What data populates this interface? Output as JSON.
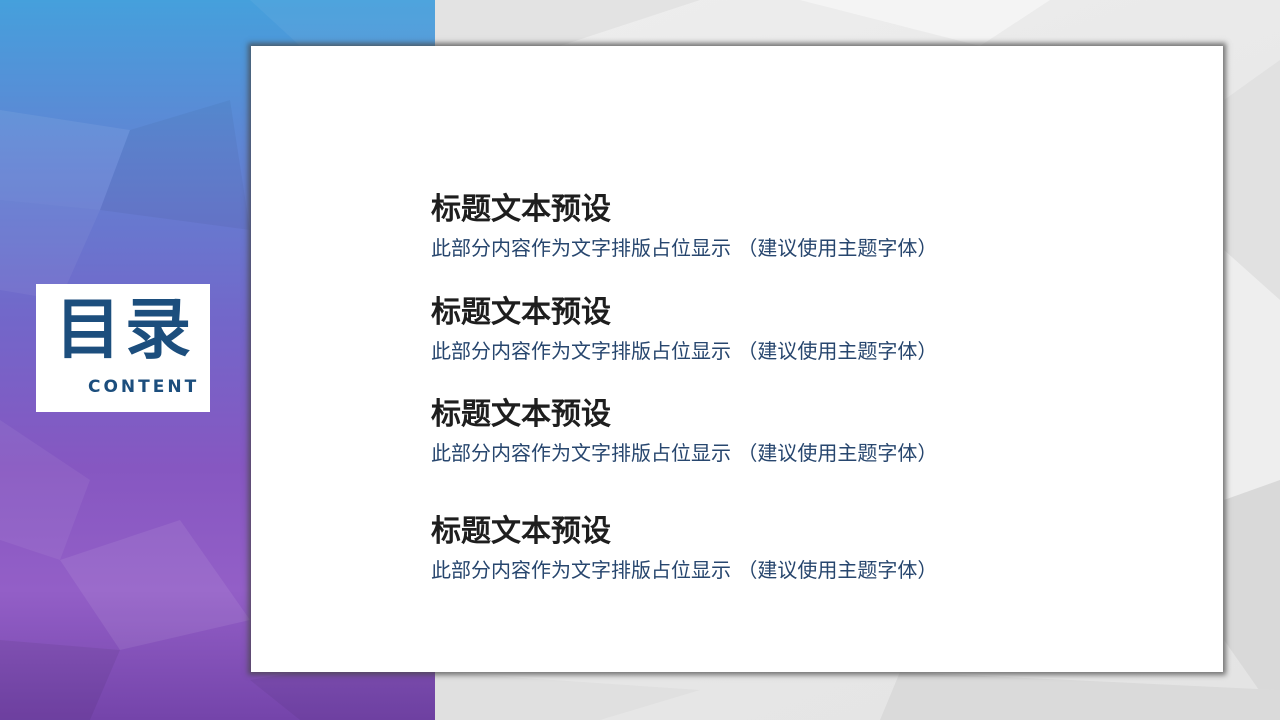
{
  "toc": {
    "title": "目录",
    "subtitle": "CONTENT"
  },
  "items": [
    {
      "title": "标题文本预设",
      "desc": "此部分内容作为文字排版占位显示 （建议使用主题字体）"
    },
    {
      "title": "标题文本预设",
      "desc": "此部分内容作为文字排版占位显示 （建议使用主题字体）"
    },
    {
      "title": "标题文本预设",
      "desc": "此部分内容作为文字排版占位显示 （建议使用主题字体）"
    },
    {
      "title": "标题文本预设",
      "desc": "此部分内容作为文字排版占位显示 （建议使用主题字体）"
    }
  ],
  "colors": {
    "accent": "#1c4e7d",
    "title_text": "#1e1e1e",
    "desc_text": "#27466e",
    "gradient_top": "#45a0dc",
    "gradient_bottom": "#7444aa",
    "background_gray": "#ebebeb"
  }
}
